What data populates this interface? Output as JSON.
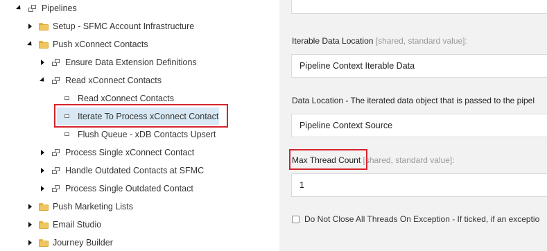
{
  "tree": {
    "pipelines": "Pipelines",
    "setup_sfmc": "Setup - SFMC Account Infrastructure",
    "push_xconnect_contacts": "Push xConnect Contacts",
    "ensure_data_extension": "Ensure Data Extension Definitions",
    "read_xconnect_contacts_parent": "Read xConnect Contacts",
    "read_xconnect_contacts_leaf": "Read xConnect Contacts",
    "iterate_to_process": "Iterate To Process xConnect Contact",
    "flush_queue": "Flush Queue - xDB Contacts Upsert",
    "process_single_contact": "Process Single xConnect Contact",
    "handle_outdated": "Handle Outdated Contacts at SFMC",
    "process_single_outdated": "Process Single Outdated Contact",
    "push_marketing_lists": "Push Marketing Lists",
    "email_studio": "Email Studio",
    "journey_builder": "Journey Builder"
  },
  "panel": {
    "iterable_label": "Iterable Data Location",
    "iterable_meta": "[shared, standard value]:",
    "iterable_value": "Pipeline Context Iterable Data",
    "data_location_label": "Data Location - The iterated data object that is passed to the pipel",
    "data_location_value": "Pipeline Context Source",
    "max_thread_label": "Max Thread Count",
    "max_thread_meta": "[shared, standard value]:",
    "max_thread_value": "1",
    "do_not_close_label": "Do Not Close All Threads On Exception - If ticked, if an exceptio"
  },
  "colors": {
    "highlight": "#d6232c",
    "selection": "#d8e9f5",
    "panel_bg": "#f2f2f2",
    "folder": "#f0c75e"
  }
}
